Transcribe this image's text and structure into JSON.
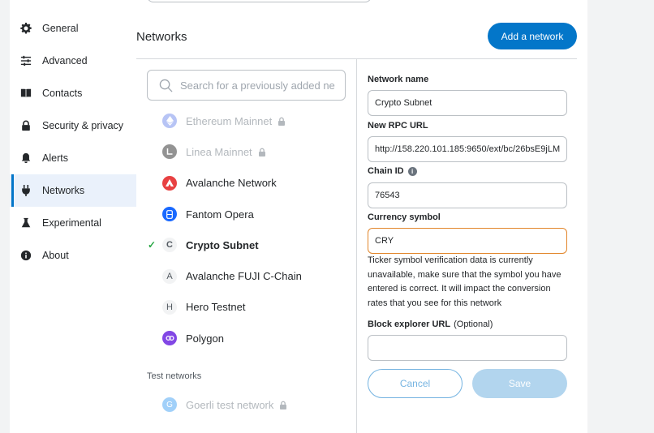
{
  "sidebar": {
    "items": [
      {
        "label": "General",
        "icon": "gear-icon"
      },
      {
        "label": "Advanced",
        "icon": "sliders-icon"
      },
      {
        "label": "Contacts",
        "icon": "book-icon"
      },
      {
        "label": "Security & privacy",
        "icon": "lock-icon"
      },
      {
        "label": "Alerts",
        "icon": "bell-icon"
      },
      {
        "label": "Networks",
        "icon": "plug-icon"
      },
      {
        "label": "Experimental",
        "icon": "flask-icon"
      },
      {
        "label": "About",
        "icon": "info-icon"
      }
    ],
    "active": "Networks"
  },
  "header": {
    "title": "Networks",
    "add_button": "Add a network"
  },
  "search": {
    "placeholder": "Search for a previously added ne"
  },
  "networks": [
    {
      "name": "Ethereum Mainnet",
      "icon": "ethereum-icon",
      "disabled": true,
      "locked": true
    },
    {
      "name": "Linea Mainnet",
      "icon": "linea-icon",
      "disabled": true,
      "locked": true
    },
    {
      "name": "Avalanche Network",
      "icon": "avalanche-icon"
    },
    {
      "name": "Fantom Opera",
      "icon": "fantom-icon"
    },
    {
      "name": "Crypto Subnet",
      "letter": "C",
      "selected": true
    },
    {
      "name": "Avalanche FUJI C-Chain",
      "letter": "A"
    },
    {
      "name": "Hero Testnet",
      "letter": "H"
    },
    {
      "name": "Polygon",
      "icon": "polygon-icon"
    }
  ],
  "test_networks": {
    "label": "Test networks",
    "items": [
      {
        "name": "Goerli test network",
        "letter": "G",
        "disabled": true,
        "locked": true
      }
    ]
  },
  "form": {
    "network_name_label": "Network name",
    "network_name_value": "Crypto Subnet",
    "rpc_url_label": "New RPC URL",
    "rpc_url_value": "http://158.220.101.185:9650/ext/bc/26bsE9jLM",
    "chain_id_label": "Chain ID",
    "chain_id_value": "76543",
    "currency_symbol_label": "Currency symbol",
    "currency_symbol_value": "CRY",
    "currency_warning": "Ticker symbol verification data is currently unavailable, make sure that the symbol you have entered is correct. It will impact the conversion rates that you see for this network",
    "block_explorer_label": "Block explorer URL",
    "block_explorer_optional": "(Optional)",
    "block_explorer_value": "",
    "cancel_label": "Cancel",
    "save_label": "Save"
  },
  "colors": {
    "accent": "#0376c9",
    "warning_border": "#e2862b",
    "check": "#28a745"
  }
}
